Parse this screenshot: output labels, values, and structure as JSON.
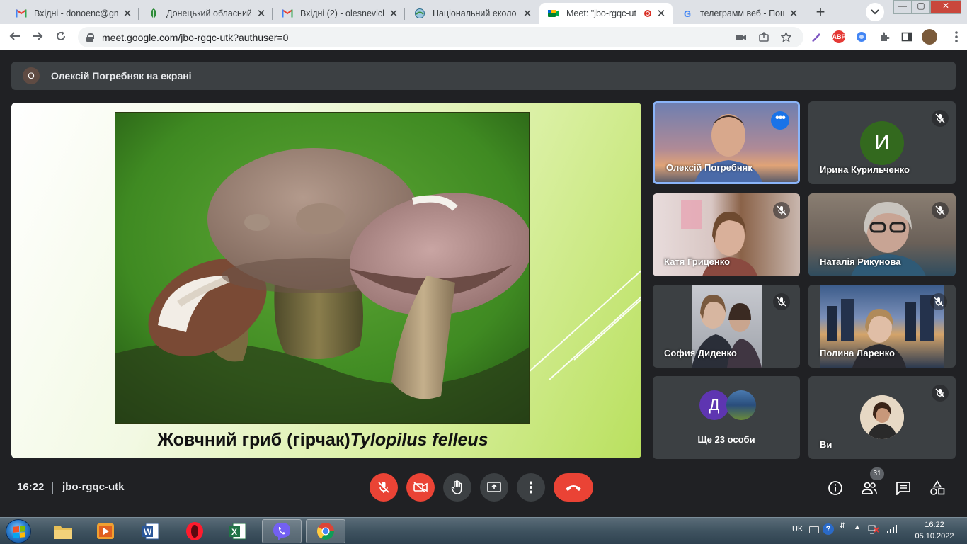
{
  "browser": {
    "tabs": [
      {
        "title": "Вхідні - donoenc@gma",
        "icon": "gmail-icon"
      },
      {
        "title": "Донецький обласний е",
        "icon": "site-icon"
      },
      {
        "title": "Вхідні (2) - olesnevich8",
        "icon": "gmail-icon"
      },
      {
        "title": "Національний еколого",
        "icon": "site-icon"
      },
      {
        "title": "Meet: \"jbo-rgqc-ut",
        "icon": "meet-icon",
        "active": true,
        "recording": true
      },
      {
        "title": "телеграмм веб - Пошу",
        "icon": "google-icon"
      }
    ],
    "new_tab": "+",
    "url": "meet.google.com/jbo-rgqc-utk?authuser=0"
  },
  "meet": {
    "presenter_avatar": "О",
    "presenter_text": "Олексій Погребняк на екрані",
    "slide": {
      "caption_main": "Жовчний гриб (гірчак)",
      "caption_latin": "Tylopilus felleus"
    },
    "participants": [
      {
        "name": "Олексій Погребняк",
        "speaking": true
      },
      {
        "name": "Ирина Курильченко",
        "avatar": "И",
        "avatar_color": "#33691e"
      },
      {
        "name": "Катя Гриценко"
      },
      {
        "name": "Наталія Рикунова"
      },
      {
        "name": "София Диденко"
      },
      {
        "name": "Полина Ларенко"
      },
      {
        "name": "Ще 23 особи",
        "avatar": "Д",
        "avatar_color": "#5e35b1"
      },
      {
        "name": "Ви"
      }
    ],
    "time": "16:22",
    "meeting_code": "jbo-rgqc-utk",
    "people_count": "31"
  },
  "taskbar": {
    "lang": "UK",
    "clock_time": "16:22",
    "clock_date": "05.10.2022"
  }
}
